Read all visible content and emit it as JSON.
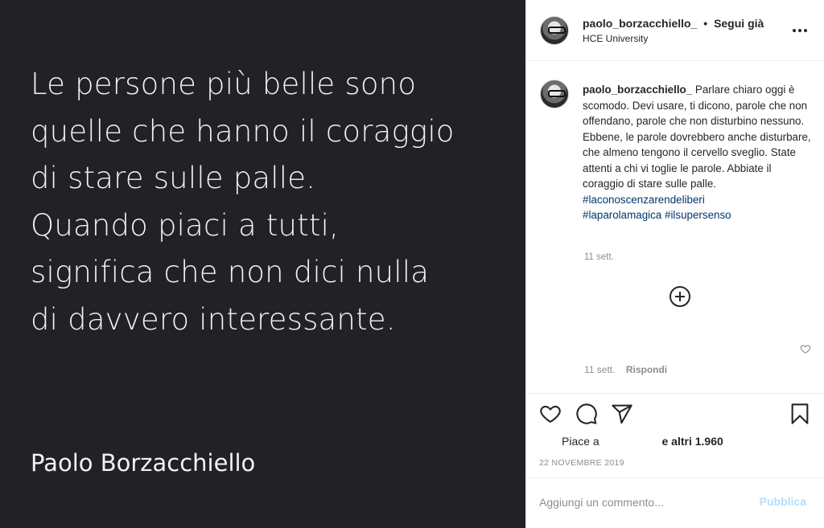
{
  "post_image": {
    "quote_lines": [
      "Le persone più belle sono",
      "quelle che hanno il coraggio",
      "di stare sulle palle.",
      "Quando piaci a tutti,",
      "significa che non dici nulla",
      "di davvero interessante."
    ],
    "author": "Paolo Borzacchiello"
  },
  "header": {
    "username": "paolo_borzacchiello_",
    "separator": "•",
    "follow_status": "Segui già",
    "location": "HCE University",
    "more_icon": "more-horizontal-icon"
  },
  "caption": {
    "username": "paolo_borzacchiello_",
    "text": "Parlare chiaro oggi è scomodo. Devi usare, ti dicono, parole che non offendano, parole che non disturbino nessuno. Ebbene, le parole dovrebbero anche disturbare, che almeno tengono il cervello sveglio. State attenti a chi vi toglie le parole. Abbiate il coraggio di stare sulle palle.",
    "hashtags": [
      "#laconoscenzarendeliberi",
      "#laparolamagica",
      "#ilsupersenso"
    ],
    "time": "11 sett."
  },
  "comment": {
    "time": "11 sett.",
    "reply_label": "Rispondi"
  },
  "actions": {
    "likes_prefix": "Piace a",
    "likes_suffix": "e altri 1.960",
    "date": "22 NOVEMBRE 2019"
  },
  "comment_box": {
    "placeholder": "Aggiungi un commento...",
    "publish_label": "Pubblica"
  },
  "colors": {
    "image_background": "#212126",
    "link": "#00376b",
    "muted": "#8e8e8e",
    "publish_disabled": "#b2dffc"
  }
}
